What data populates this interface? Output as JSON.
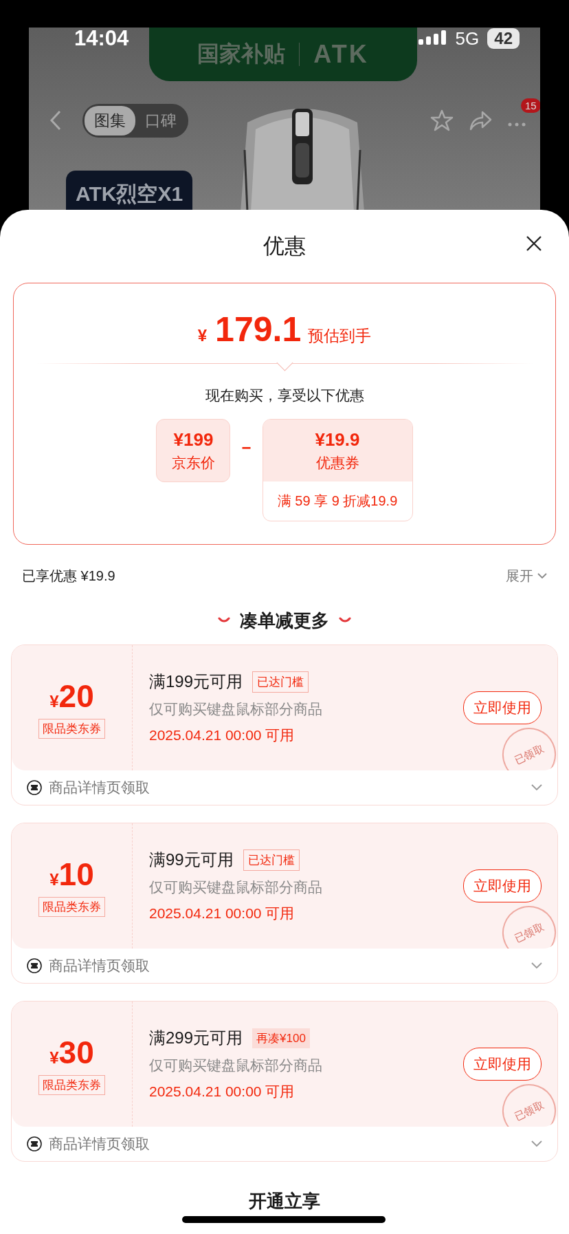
{
  "status_bar": {
    "time": "14:04",
    "network": "5G",
    "battery": "42"
  },
  "background_page": {
    "banner": {
      "left": "国家补贴",
      "right": "ATK"
    },
    "tabs": [
      {
        "label": "图集",
        "selected": true
      },
      {
        "label": "口碑",
        "selected": false
      }
    ],
    "more_badge": "15",
    "product_label": "ATK烈空X1"
  },
  "sheet": {
    "title": "优惠",
    "estimate": {
      "currency": "¥",
      "price": "179.1",
      "label": "预估到手",
      "caption": "现在购买，享受以下优惠",
      "base": {
        "amount": "¥199",
        "label": "京东价"
      },
      "operator": "−",
      "discount": {
        "amount": "¥19.9",
        "label": "优惠券",
        "rule": "满 59 享 9 折减19.9"
      }
    },
    "applied": {
      "label": "已享优惠 ¥19.9",
      "toggle": "展开"
    },
    "section_title": "凑单减更多",
    "coupons": [
      {
        "currency": "¥",
        "amount": "20",
        "type": "限品类东券",
        "title": "满199元可用",
        "tag": {
          "text": "已达门槛",
          "kind": "reached"
        },
        "scope": "仅可购买键盘鼠标部分商品",
        "valid": "2025.04.21 00:00 可用",
        "button": "立即使用",
        "stamp": "已领取",
        "source": "商品详情页领取"
      },
      {
        "currency": "¥",
        "amount": "10",
        "type": "限品类东券",
        "title": "满99元可用",
        "tag": {
          "text": "已达门槛",
          "kind": "reached"
        },
        "scope": "仅可购买键盘鼠标部分商品",
        "valid": "2025.04.21 00:00 可用",
        "button": "立即使用",
        "stamp": "已领取",
        "source": "商品详情页领取"
      },
      {
        "currency": "¥",
        "amount": "30",
        "type": "限品类东券",
        "title": "满299元可用",
        "tag": {
          "text": "再凑¥100",
          "kind": "short"
        },
        "scope": "仅可购买键盘鼠标部分商品",
        "valid": "2025.04.21 00:00 可用",
        "button": "立即使用",
        "stamp": "已领取",
        "source": "商品详情页领取"
      }
    ],
    "footer_title": "开通立享"
  }
}
